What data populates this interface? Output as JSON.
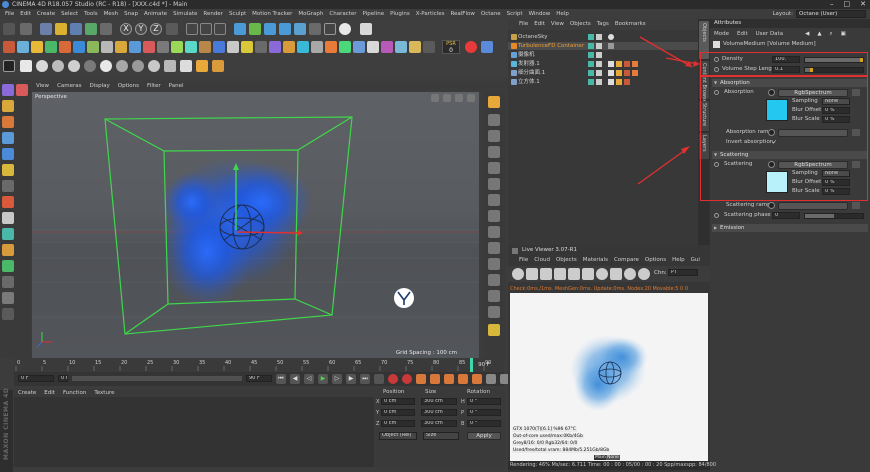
{
  "window": {
    "title": "CINEMA 4D R18.057 Studio (RC - R18) - [XXX.c4d *] - Main",
    "controls": [
      "–",
      "□",
      "✕"
    ]
  },
  "menubar": [
    "File",
    "Edit",
    "Create",
    "Select",
    "Tools",
    "Mesh",
    "Snap",
    "Animate",
    "Simulate",
    "Render",
    "Sculpt",
    "Motion Tracker",
    "MoGraph",
    "Character",
    "Pipeline",
    "Plugins",
    "X-Particles",
    "RealFlow",
    "Octane",
    "Script",
    "Window",
    "Help"
  ],
  "layout": {
    "label": "Layout:",
    "value": "Octane (User)"
  },
  "toolbar": {
    "axes": [
      "X",
      "Y",
      "Z"
    ],
    "psr_label": "PSR",
    "psr_value": "0"
  },
  "viewport": {
    "menu": [
      "View",
      "Cameras",
      "Display",
      "Options",
      "Filter",
      "Panel"
    ],
    "label": "Perspective",
    "grid_spacing": "Grid Spacing : 100 cm"
  },
  "timeline": {
    "ticks": [
      "0",
      "5",
      "10",
      "15",
      "20",
      "25",
      "30",
      "35",
      "40",
      "45",
      "50",
      "55",
      "60",
      "65",
      "70",
      "75",
      "80",
      "85",
      "90"
    ],
    "end_frame": "90 F",
    "current_frame": "0 F",
    "start_field": "0 F",
    "end_field": "90 F",
    "min_field": "90 F",
    "frame_counter": "0 F"
  },
  "material_manager": {
    "menu": [
      "Create",
      "Edit",
      "Function",
      "Texture"
    ],
    "side_label": "MAXON CINEMA 4D"
  },
  "coordinates": {
    "headers": [
      "Position",
      "Size",
      "Rotation"
    ],
    "rows": [
      {
        "pos": "0 cm",
        "axis_p": "X",
        "size": "300 cm",
        "axis_s": "H",
        "rot": "0 °"
      },
      {
        "pos": "0 cm",
        "axis_p": "Y",
        "size": "300 cm",
        "axis_s": "P",
        "rot": "0 °"
      },
      {
        "pos": "0 cm",
        "axis_p": "Z",
        "size": "300 cm",
        "axis_s": "B",
        "rot": "0 °"
      }
    ],
    "mode": "Object (Rel)",
    "size_mode": "Size",
    "apply": "Apply"
  },
  "object_manager": {
    "menu": [
      "File",
      "Edit",
      "View",
      "Objects",
      "Tags",
      "Bookmarks"
    ],
    "objects": [
      {
        "name": "OctaneSky",
        "color": "#c7a04a"
      },
      {
        "name": "TurbulenceFD Container",
        "color": "#e88a2a",
        "selected": true
      },
      {
        "name": "摄像机",
        "color": "#6a9fd6"
      },
      {
        "name": "发射器.1",
        "color": "#5bb5d6"
      },
      {
        "name": "细分曲面.1",
        "color": "#7fa0c8"
      },
      {
        "name": "立方体.1",
        "color": "#7fa0c8"
      }
    ]
  },
  "side_tabs": [
    "Objects",
    "Content Browser",
    "Structure",
    "Layers",
    "Attributes"
  ],
  "attributes": {
    "header": "Attributes",
    "menu": [
      "Mode",
      "Edit",
      "User Data"
    ],
    "object_label": "VolumeMedium [Volume Medium]",
    "density_label": "Density",
    "density_value": "100.",
    "step_label": "Volume Step Length",
    "step_value": "0.1",
    "absorption_section": "Absorption",
    "absorption_label": "Absorption",
    "absorption_type": "RgbSpectrum",
    "absorption_color": "#24c7f0",
    "sampling_label": "Sampling",
    "sampling_value": "None",
    "blur_offset_label": "Blur Offset",
    "blur_offset_value": "0 %",
    "blur_scale_label": "Blur Scale",
    "blur_scale_value": "0 %",
    "absorption_ramp_label": "Absorption ramp",
    "invert_label": "Invert absorption",
    "invert_checked": "✓",
    "scattering_section": "Scattering",
    "scattering_label": "Scattering",
    "scattering_type": "RgbSpectrum",
    "scattering_color": "#b9f1fb",
    "sc_sampling_value": "None",
    "sc_blur_offset_value": "0 %",
    "sc_blur_scale_value": "0 %",
    "scattering_ramp_label": "Scattering ramp",
    "scattering_phase_label": "Scattering phase",
    "scattering_phase_value": "0",
    "emission_section": "Emission"
  },
  "live_viewer": {
    "title": "Live Viewer 3.07-R1",
    "menu": [
      "File",
      "Cloud",
      "Objects",
      "Materials",
      "Compare",
      "Options",
      "Help",
      "Gui"
    ],
    "chn_label": "Chn:",
    "chn_value": "PT",
    "status": "Check:0ms./1ms. MeshGen:0ms. Update:0ms. Nodes:20 Movable:5 0 0",
    "info": [
      "GTX 1070(T)[6.1]        %96    67°C",
      "Out-of-core used/max:0Kb/4Gb",
      "Grey8/16: 0/0          Rgb32/64: 0/0",
      "Used/free/total vram: 884Mb/5.251Gb/8Gb"
    ],
    "main_label": "Main",
    "none_label": "None",
    "bottom": "Rendering: 46%  Ms/sec: 6.711    Time: 00 : 00 : 05/00 : 00 : 20    Spp/maxspp: 84/800"
  }
}
